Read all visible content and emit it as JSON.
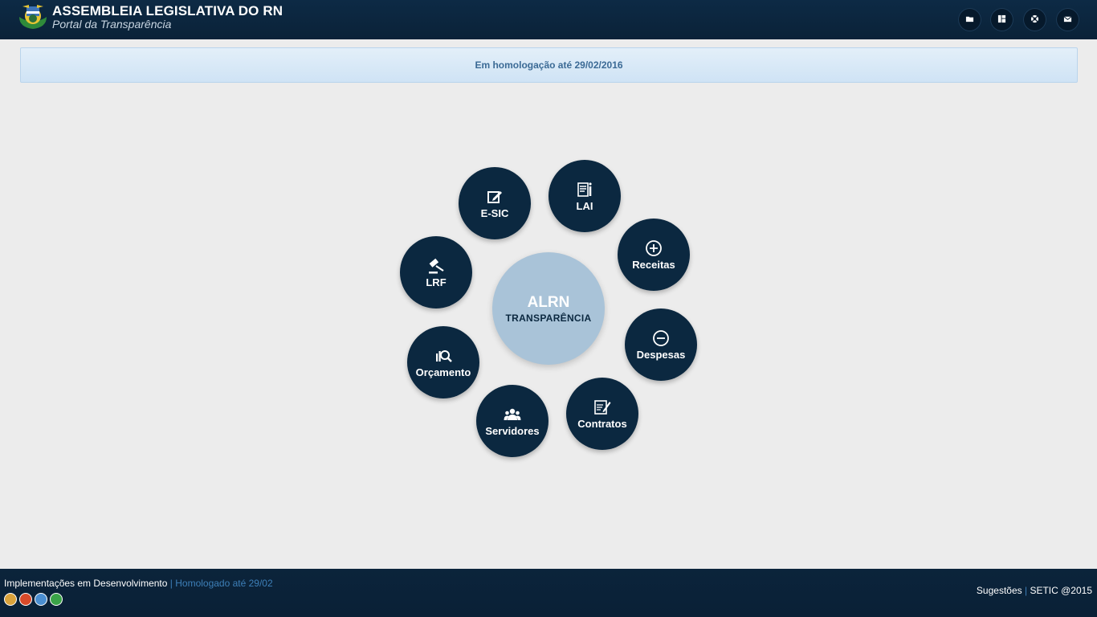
{
  "header": {
    "title": "ASSEMBLEIA LEGISLATIVA DO RN",
    "subtitle": "Portal da Transparência",
    "buttons": [
      {
        "icon": "folder-icon"
      },
      {
        "icon": "layout-icon"
      },
      {
        "icon": "lifebuoy-icon"
      },
      {
        "icon": "mail-icon"
      }
    ]
  },
  "notice": {
    "text": "Em homologação até 29/02/2016"
  },
  "hub": {
    "center_title": "ALRN",
    "center_subtitle": "TRANSPARÊNCIA",
    "items": [
      {
        "label": "E-SIC",
        "icon": "edit-icon"
      },
      {
        "label": "LAI",
        "icon": "info-document-icon"
      },
      {
        "label": "Receitas",
        "icon": "plus-circle-icon"
      },
      {
        "label": "Despesas",
        "icon": "minus-circle-icon"
      },
      {
        "label": "Contratos",
        "icon": "contract-icon"
      },
      {
        "label": "Servidores",
        "icon": "users-icon"
      },
      {
        "label": "Orçamento",
        "icon": "search-chart-icon"
      },
      {
        "label": "LRF",
        "icon": "gavel-icon"
      }
    ]
  },
  "footer": {
    "left_text": "Implementações em Desenvolvimento",
    "left_sep": " | ",
    "left_highlight": "Homologado até 29/02",
    "right_link": "Sugestões",
    "right_sep": " | ",
    "right_text": "SETIC @2015",
    "badge_colors": [
      "#d9a23b",
      "#d84a2a",
      "#4a8ed0",
      "#3aa348"
    ]
  },
  "colors": {
    "header_bg": "#0d2a45",
    "circle_bg": "#0b2840",
    "center_bg": "#a9c3d8",
    "notice_text": "#3b6a95",
    "accent": "#3d7fb8"
  }
}
